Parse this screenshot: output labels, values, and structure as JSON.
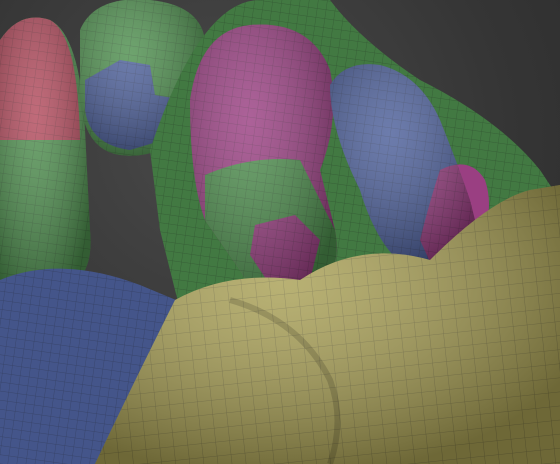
{
  "scene": {
    "subject": "sculpted-hand-mesh-with-polygroups",
    "palette": {
      "background": "#3a3a3a",
      "red_group": "#b24a5c",
      "green_group": "#4e8f4e",
      "blue_group": "#4c5f9a",
      "magenta_group": "#9a3f82",
      "yellow_group": "#a9a055",
      "wire": "#1c1c1c"
    }
  }
}
